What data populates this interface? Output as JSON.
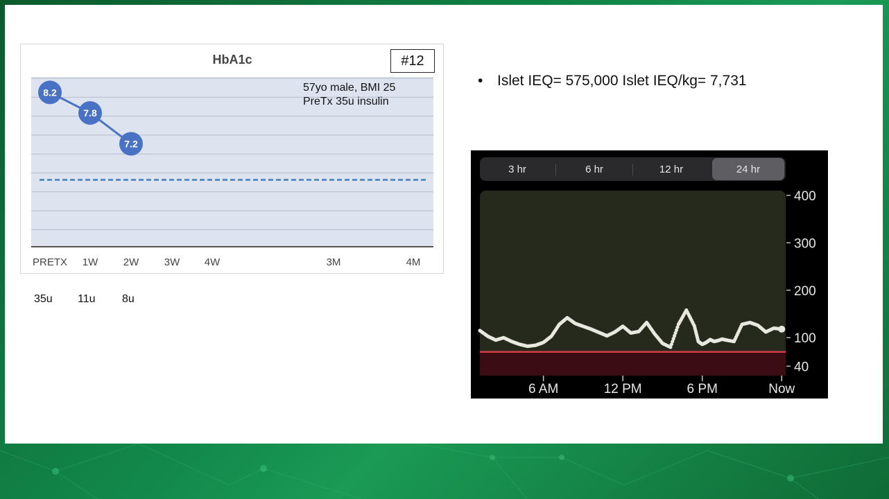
{
  "slide_label": "#12",
  "patient_note": [
    "57yo male, BMI 25",
    "PreTx 35u insulin"
  ],
  "insulin_doses": [
    {
      "category": "PRETX",
      "dose": "35u"
    },
    {
      "category": "1W",
      "dose": "11u"
    },
    {
      "category": "2W",
      "dose": "8u"
    }
  ],
  "bullet": {
    "symbol": "•",
    "text": "Islet IEQ= 575,000  Islet IEQ/kg= 7,731"
  },
  "cgm": {
    "ranges": [
      {
        "label": "3 hr",
        "active": false
      },
      {
        "label": "6 hr",
        "active": false
      },
      {
        "label": "12 hr",
        "active": false
      },
      {
        "label": "24 hr",
        "active": true
      }
    ]
  },
  "colors": {
    "hba_plot_bg": "#dde4f0",
    "hba_point": "#4a72c4",
    "hba_target_line": "#3f7fc0",
    "cgm_plot_bg": "#262a1c",
    "cgm_low_band": "#3a0d12",
    "cgm_low_line": "#d83a4a",
    "cgm_trace": "#e8e8e0"
  },
  "chart_data": [
    {
      "type": "line",
      "title": "HbA1c",
      "categories": [
        "PRETX",
        "1W",
        "2W",
        "3W",
        "4W",
        "3M",
        "4M"
      ],
      "series": [
        {
          "values": [
            8.2,
            7.8,
            7.2,
            null,
            null,
            null,
            null
          ],
          "labels": [
            "8.2",
            "7.8",
            "7.2"
          ]
        }
      ],
      "reference_line": {
        "y": 6.5,
        "style": "dashed"
      },
      "ylim": [
        5.2,
        8.5
      ],
      "grid": true,
      "legend": "none"
    },
    {
      "type": "scatter",
      "title": "",
      "x_tick_labels": [
        "6 AM",
        "12 PM",
        "6 PM",
        "Now"
      ],
      "x_ticks_hours": [
        6,
        12,
        18,
        24
      ],
      "xlim_hours": [
        1.2,
        24.3
      ],
      "y_tick_values": [
        400,
        300,
        200,
        100,
        40
      ],
      "y_tick_labels": [
        "400",
        "300",
        "200",
        "100",
        "40"
      ],
      "ylim": [
        20,
        410
      ],
      "low_threshold": 70,
      "x_hours": [
        1.2,
        1.8,
        2.4,
        3.0,
        3.6,
        4.2,
        4.8,
        5.4,
        6.0,
        6.6,
        7.2,
        7.8,
        8.4,
        9.0,
        9.6,
        10.2,
        10.8,
        11.4,
        12.0,
        12.6,
        13.2,
        13.8,
        14.4,
        15.0,
        15.6,
        16.2,
        16.8,
        17.4,
        17.7,
        18.0,
        18.3,
        18.6,
        18.9,
        19.2,
        19.5,
        19.8,
        20.4,
        21.0,
        21.6,
        22.2,
        22.8,
        23.4,
        24.0
      ],
      "y": [
        115,
        103,
        95,
        100,
        92,
        86,
        82,
        84,
        90,
        103,
        128,
        142,
        130,
        124,
        118,
        111,
        104,
        112,
        124,
        110,
        113,
        132,
        108,
        88,
        80,
        128,
        158,
        125,
        92,
        86,
        90,
        96,
        92,
        94,
        97,
        95,
        92,
        128,
        132,
        126,
        112,
        120,
        118
      ]
    }
  ]
}
